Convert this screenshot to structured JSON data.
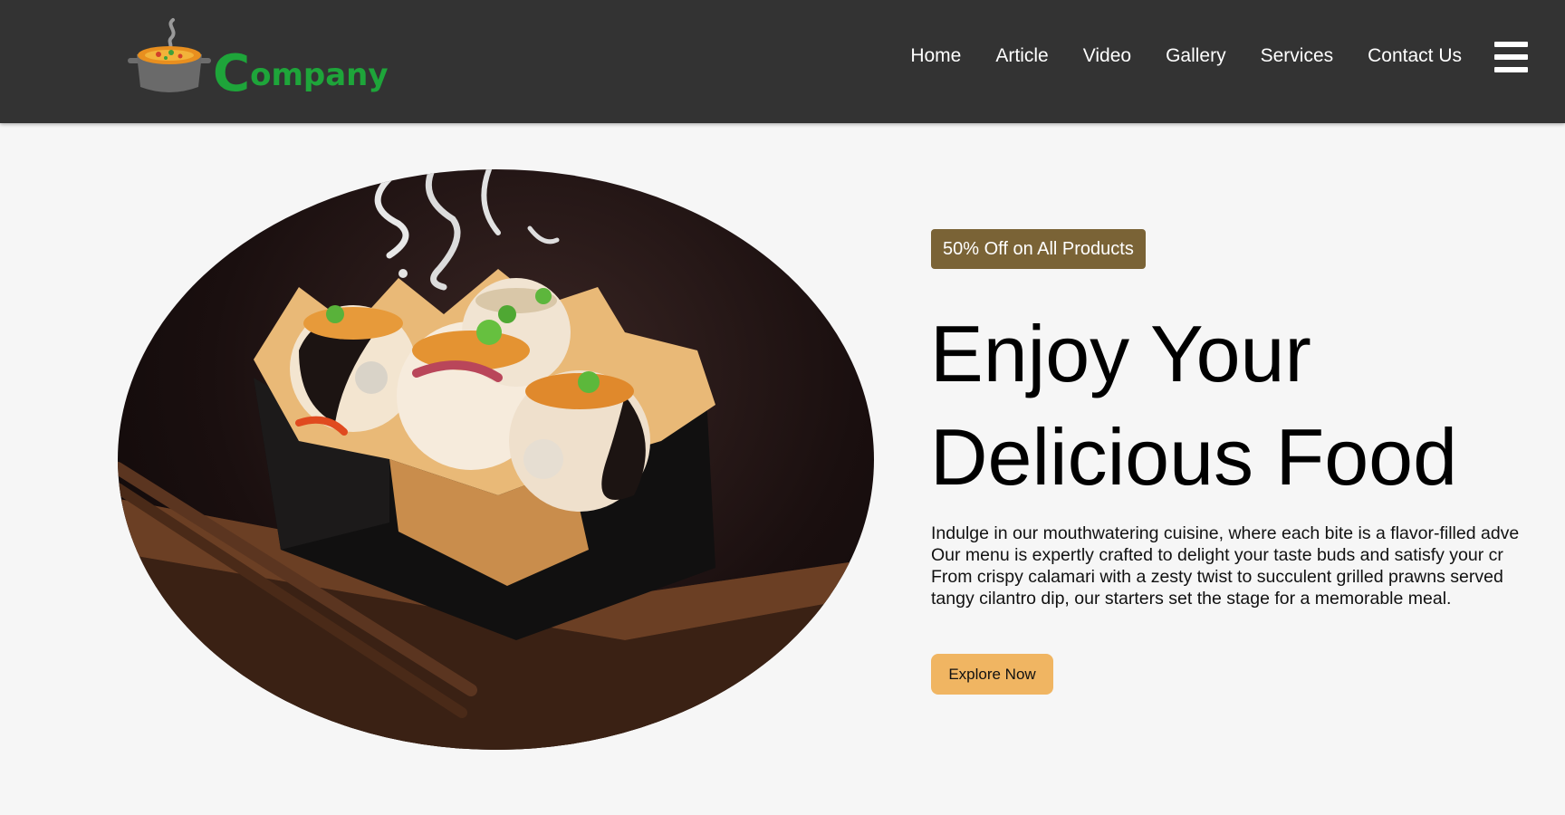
{
  "brand": {
    "name_initial": "C",
    "name_rest": "ompany",
    "color": "#1ea53a",
    "icon": "cooking-pot-icon"
  },
  "nav": {
    "items": [
      "Home",
      "Article",
      "Video",
      "Gallery",
      "Services",
      "Contact Us"
    ],
    "menu_icon": "hamburger-menu-icon"
  },
  "hero": {
    "badge": "50% Off on All Products",
    "headline_line1": "Enjoy Your",
    "headline_line2": "Delicious Food",
    "description": "Indulge in our mouthwatering cuisine, where each bite is a flavor-filled adve Our menu is expertly crafted to delight your taste buds and satisfy your cr From crispy calamari with a zesty twist to succulent grilled prawns served tangy cilantro dip, our starters set the stage for a memorable meal.",
    "cta_label": "Explore Now",
    "image": "food-in-box-with-chopsticks"
  },
  "colors": {
    "navbar": "#333333",
    "page_bg": "#f6f6f6",
    "badge_bg": "#7a6336",
    "cta_bg": "#f0b562"
  }
}
